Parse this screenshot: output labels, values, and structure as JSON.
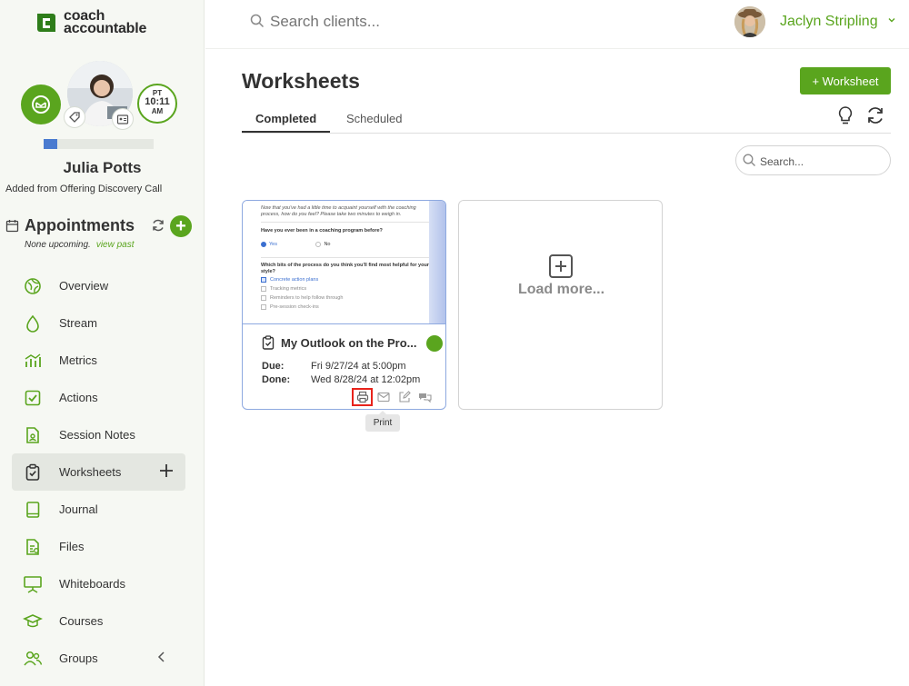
{
  "logo": {
    "line1": "coach",
    "line2": "accountable"
  },
  "client": {
    "name": "Julia Potts",
    "source": "Added from Offering Discovery Call",
    "clock": {
      "tz": "PT",
      "time": "10:11",
      "ampm": "AM"
    },
    "progress_fraction": 0.12
  },
  "appointments": {
    "title": "Appointments",
    "status": "None upcoming.",
    "view_past": "view past"
  },
  "nav": {
    "items": [
      {
        "label": "Overview",
        "icon": "overview-icon"
      },
      {
        "label": "Stream",
        "icon": "stream-icon"
      },
      {
        "label": "Metrics",
        "icon": "metrics-icon"
      },
      {
        "label": "Actions",
        "icon": "actions-icon"
      },
      {
        "label": "Session Notes",
        "icon": "session-notes-icon"
      },
      {
        "label": "Worksheets",
        "icon": "worksheets-icon",
        "active": true
      },
      {
        "label": "Journal",
        "icon": "journal-icon"
      },
      {
        "label": "Files",
        "icon": "files-icon"
      },
      {
        "label": "Whiteboards",
        "icon": "whiteboards-icon"
      },
      {
        "label": "Courses",
        "icon": "courses-icon"
      },
      {
        "label": "Groups",
        "icon": "groups-icon"
      }
    ]
  },
  "topbar": {
    "search_placeholder": "Search clients...",
    "user_name": "Jaclyn Stripling"
  },
  "page": {
    "title": "Worksheets",
    "add_button": "+ Worksheet",
    "tabs": [
      {
        "label": "Completed",
        "active": true
      },
      {
        "label": "Scheduled"
      }
    ],
    "search_placeholder": "Search..."
  },
  "card": {
    "preview": {
      "intro": "Now that you've had a little time to acquaint yourself with the coaching process, how do you feel? Please take two minutes to weigh in.",
      "q1": "Have you ever been in a coaching program before?",
      "q1_yes": "Yes",
      "q1_no": "No",
      "q2": "Which bits of the process do you think you'll find most helpful for your style?",
      "options": [
        "Concrete action plans",
        "Tracking metrics",
        "Reminders to help follow through",
        "Pre-session check-ins"
      ]
    },
    "title": "My Outlook on the Pro...",
    "due_label": "Due:",
    "due_value": "Fri 9/27/24 at 5:00pm",
    "done_label": "Done:",
    "done_value": "Wed 8/28/24 at 12:02pm",
    "status_color": "#5aa51e"
  },
  "tooltip": "Print",
  "load_more": "Load more...",
  "colors": {
    "brand_green": "#5aa51e",
    "progress_blue": "#4a7bd0",
    "highlight_red": "#e8231b"
  }
}
